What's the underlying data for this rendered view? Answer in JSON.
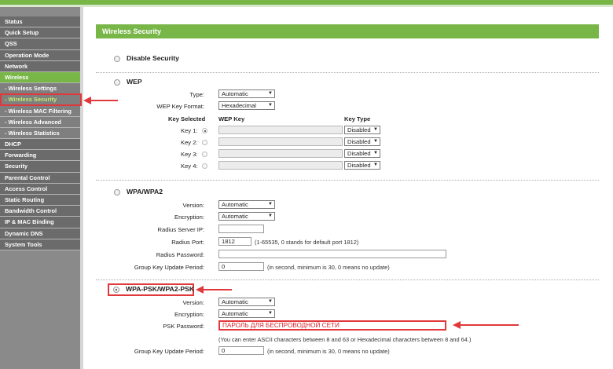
{
  "sidebar": {
    "items": [
      {
        "label": "Status"
      },
      {
        "label": "Quick Setup"
      },
      {
        "label": "QSS"
      },
      {
        "label": "Operation Mode"
      },
      {
        "label": "Network"
      },
      {
        "label": "Wireless"
      },
      {
        "label": "- Wireless Settings"
      },
      {
        "label": "- Wireless Security"
      },
      {
        "label": "- Wireless MAC Filtering"
      },
      {
        "label": "- Wireless Advanced"
      },
      {
        "label": "- Wireless Statistics"
      },
      {
        "label": "DHCP"
      },
      {
        "label": "Forwarding"
      },
      {
        "label": "Security"
      },
      {
        "label": "Parental Control"
      },
      {
        "label": "Access Control"
      },
      {
        "label": "Static Routing"
      },
      {
        "label": "Bandwidth Control"
      },
      {
        "label": "IP & MAC Binding"
      },
      {
        "label": "Dynamic DNS"
      },
      {
        "label": "System Tools"
      }
    ]
  },
  "page": {
    "title": "Wireless Security"
  },
  "disable_security": {
    "label": "Disable Security"
  },
  "wep": {
    "label": "WEP",
    "type_label": "Type:",
    "type_value": "Automatic",
    "format_label": "WEP Key Format:",
    "format_value": "Hexadecimal",
    "key_selected_header": "Key Selected",
    "wep_key_header": "WEP Key",
    "key_type_header": "Key Type",
    "keys": [
      {
        "label": "Key 1:",
        "type": "Disabled"
      },
      {
        "label": "Key 2:",
        "type": "Disabled"
      },
      {
        "label": "Key 3:",
        "type": "Disabled"
      },
      {
        "label": "Key 4:",
        "type": "Disabled"
      }
    ]
  },
  "wpa": {
    "label": "WPA/WPA2",
    "version_label": "Version:",
    "version_value": "Automatic",
    "encryption_label": "Encryption:",
    "encryption_value": "Automatic",
    "radius_ip_label": "Radius Server IP:",
    "radius_port_label": "Radius Port:",
    "radius_port_value": "1812",
    "radius_port_hint": "(1-65535, 0 stands for default port 1812)",
    "radius_password_label": "Radius Password:",
    "group_key_label": "Group Key Update Period:",
    "group_key_value": "0",
    "group_key_hint": "(in second, minimum is 30, 0 means no update)"
  },
  "wpa_psk": {
    "label": "WPA-PSK/WPA2-PSK",
    "version_label": "Version:",
    "version_value": "Automatic",
    "encryption_label": "Encryption:",
    "encryption_value": "Automatic",
    "psk_label": "PSK Password:",
    "psk_value": "ПАРОЛЬ ДЛЯ БЕСПРОВОДНОЙ СЕТИ",
    "psk_hint": "(You can enter ASCII characters between 8 and 63 or Hexadecimal characters between 8 and 64.)",
    "group_key_label": "Group Key Update Period:",
    "group_key_value": "0",
    "group_key_hint": "(in second, minimum is 30, 0 means no update)"
  },
  "colors": {
    "accent": "#79b648",
    "annotation": "#e0383b"
  }
}
